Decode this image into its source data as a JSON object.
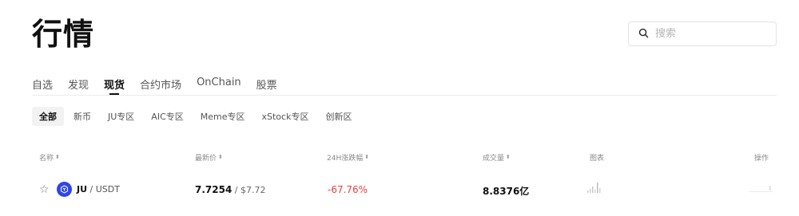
{
  "page": {
    "title": "行情"
  },
  "search": {
    "placeholder": "搜索"
  },
  "main_tabs": [
    {
      "label": "自选",
      "active": false
    },
    {
      "label": "发现",
      "active": false
    },
    {
      "label": "现货",
      "active": true
    },
    {
      "label": "合约市场",
      "active": false
    },
    {
      "label": "OnChain",
      "active": false
    },
    {
      "label": "股票",
      "active": false
    }
  ],
  "sub_tabs": [
    {
      "label": "全部",
      "active": true
    },
    {
      "label": "新币",
      "active": false
    },
    {
      "label": "JU专区",
      "active": false
    },
    {
      "label": "AIC专区",
      "active": false
    },
    {
      "label": "Meme专区",
      "active": false
    },
    {
      "label": "xStock专区",
      "active": false
    },
    {
      "label": "创新区",
      "active": false
    }
  ],
  "columns": {
    "name": "名称",
    "last_price": "最新价",
    "change_24h": "24H涨跌幅",
    "volume": "成交量",
    "chart": "图表",
    "action": "操作"
  },
  "rows": [
    {
      "base": "JU",
      "quote_sep": " / ",
      "quote": "USDT",
      "last_price": "7.7254",
      "price_sep": " / ",
      "usd_price": "$7.72",
      "change_24h": "-67.76%",
      "volume": "8.8376亿"
    }
  ],
  "colors": {
    "negative": "#e8423f",
    "coin_logo": "#2f45e8",
    "active_tab_underline": "#111111"
  },
  "icons": {
    "search": "search-icon",
    "sort": "sort-icon",
    "favorite": "star-outline-icon",
    "coin": "ju-coin-logo"
  }
}
